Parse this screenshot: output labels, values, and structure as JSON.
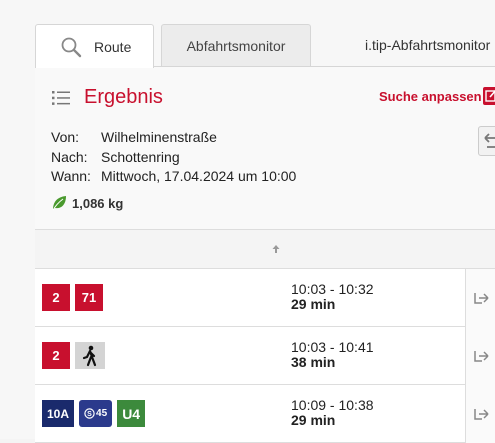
{
  "tabs": {
    "route_label": "Route",
    "abfahrtsmonitor_label": "Abfahrtsmonitor",
    "itip_label": "i.tip-Abfahrtsmonitor"
  },
  "result": {
    "title": "Ergebnis",
    "adjust_label": "Suche anpassen",
    "from_key": "Von:",
    "from_value": "Wilhelminenstraße",
    "to_key": "Nach:",
    "to_value": "Schottenring",
    "when_key": "Wann:",
    "when_value": "Mittwoch, 17.04.2024 um 10:00",
    "co2": "1,086 kg"
  },
  "connections": [
    {
      "badges": [
        "2",
        "71"
      ],
      "time": "10:03 - 10:32",
      "duration": "29 min"
    },
    {
      "badges": [
        "2"
      ],
      "time": "10:03 - 10:41",
      "duration": "38 min"
    },
    {
      "badges": [
        "10A",
        "S45",
        "U4"
      ],
      "time": "10:09 - 10:38",
      "duration": "29 min"
    }
  ],
  "colors": {
    "accent": "#c8102e",
    "tram": "#c8102e",
    "bus": "#1a2a6c",
    "sbahn": "#2b3a8c",
    "ubahn_u4": "#3c8a3c"
  },
  "icons": [
    "search-icon",
    "list-icon",
    "edit-icon",
    "swap-icon",
    "leaf-icon",
    "sort-arrow-icon",
    "walk-icon",
    "sbahn-icon",
    "details-arrow-icon"
  ]
}
